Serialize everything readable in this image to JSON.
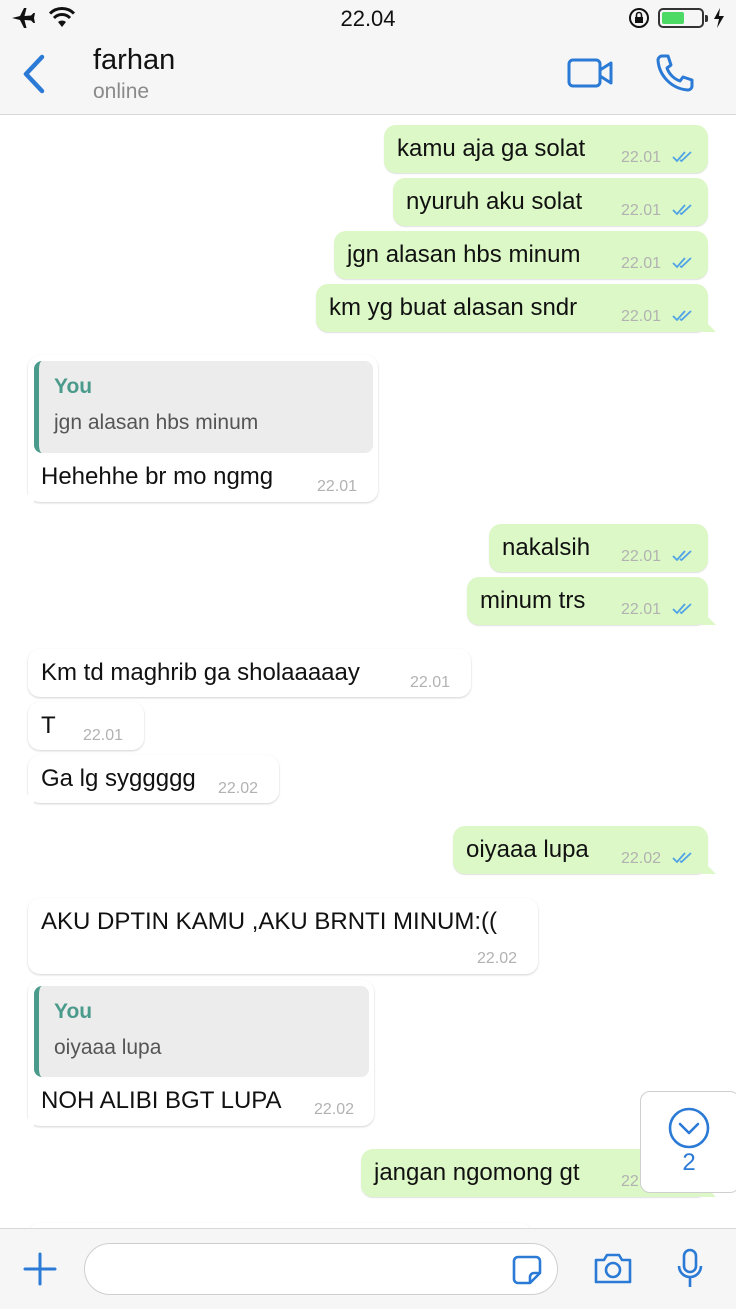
{
  "status_bar": {
    "time": "22.04"
  },
  "header": {
    "name": "farhan",
    "status": "online"
  },
  "messages": [
    {
      "text": "kamu aja ga solat",
      "time": "22.01"
    },
    {
      "text": "nyuruh aku solat",
      "time": "22.01"
    },
    {
      "text": "jgn alasan hbs minum",
      "time": "22.01"
    },
    {
      "text": "km yg buat alasan sndr",
      "time": "22.01"
    },
    {
      "quote_author": "You",
      "quote_text": "jgn alasan hbs minum",
      "text": "Hehehhe br mo ngmg",
      "time": "22.01"
    },
    {
      "text": "nakalsih",
      "time": "22.01"
    },
    {
      "text": "minum trs",
      "time": "22.01"
    },
    {
      "text": "Km td maghrib ga sholaaaaay",
      "time": "22.01"
    },
    {
      "text": "T",
      "time": "22.01"
    },
    {
      "text": "Ga lg syggggg",
      "time": "22.02"
    },
    {
      "text": "oiyaaa lupa",
      "time": "22.02"
    },
    {
      "text": "AKU DPTIN KAMU ,AKU BRNTI MINUM:((",
      "time": "22.02"
    },
    {
      "quote_author": "You",
      "quote_text": "oiyaaa lupa",
      "text": "NOH ALIBI BGT LUPA",
      "time": "22.02"
    },
    {
      "text": "jangan ngomong gt",
      "time": "22"
    }
  ],
  "scroll_down": {
    "unread_count": "2"
  },
  "input": {
    "value": ""
  },
  "colors": {
    "accent": "#2a7ad6",
    "outgoing_bubble": "#dcf8c6",
    "quote_bar": "#4b9b8d"
  }
}
